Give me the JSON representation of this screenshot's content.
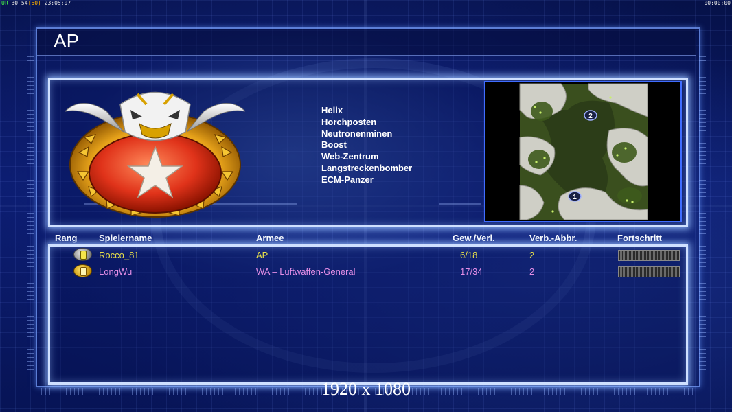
{
  "hud": {
    "left_a": "UR",
    "left_b": "30 54",
    "left_c": "[60]",
    "left_time": "23:05:07",
    "right_time": "00:00:00"
  },
  "title": "AP",
  "general_units": [
    "Helix",
    "Horchposten",
    "Neutronenminen",
    "Boost",
    "Web-Zentrum",
    "Langstreckenbomber",
    "ECM-Panzer"
  ],
  "minimap": {
    "start_positions": [
      "1",
      "2"
    ],
    "colors": {
      "terrain": "#3a4f1e",
      "rock": "#c8c8c0",
      "water": "#2a3a22"
    }
  },
  "table": {
    "headers": {
      "rank": "Rang",
      "player_name": "Spielername",
      "army": "Armee",
      "wins_losses": "Gew./Verl.",
      "disconnects": "Verb.-Abbr.",
      "progress": "Fortschritt"
    },
    "rows": [
      {
        "rank_icon": "silver-rank-icon",
        "name": "Rocco_81",
        "army": "AP",
        "wins_losses": "6/18",
        "disconnects": "2",
        "progress": 0.0,
        "color": "#e8e04a"
      },
      {
        "rank_icon": "gold-rank-icon",
        "name": "LongWu",
        "army": "WA – Luftwaffen-General",
        "wins_losses": "17/34",
        "disconnects": "2",
        "progress": 0.0,
        "color": "#e48ee6"
      }
    ]
  },
  "resolution_label": "1920 x 1080",
  "colors": {
    "accent": "#cfe0ff",
    "background": "#0a1a6a"
  }
}
